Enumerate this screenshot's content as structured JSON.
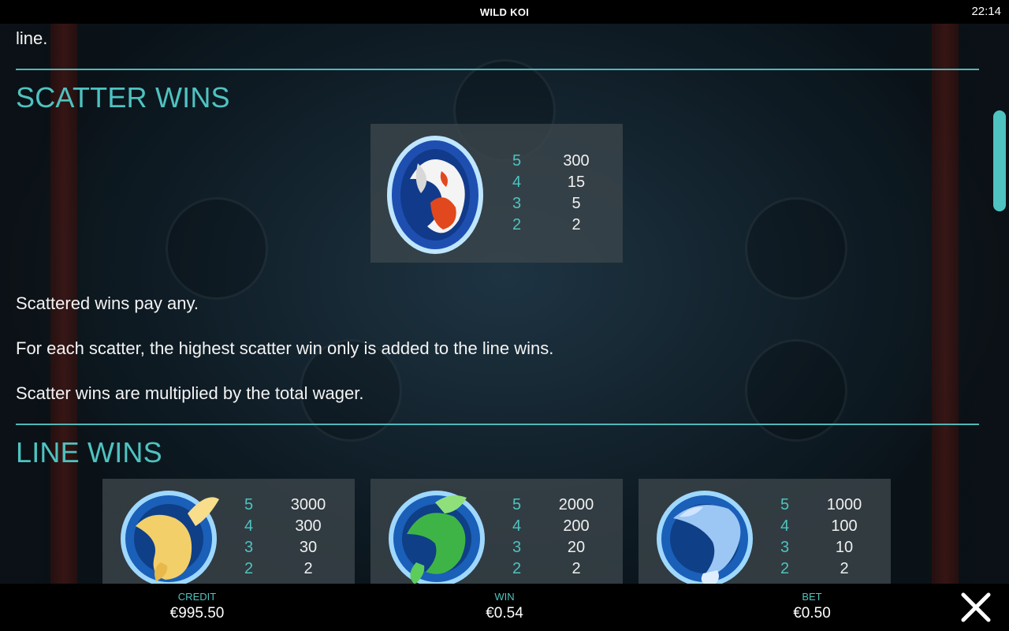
{
  "header": {
    "title": "WILD KOI",
    "clock": "22:14"
  },
  "intro_fragment": "line.",
  "scatter": {
    "heading": "SCATTER WINS",
    "symbol_icon": "scatter-koi-icon",
    "paytable": [
      {
        "count": "5",
        "value": "300"
      },
      {
        "count": "4",
        "value": "15"
      },
      {
        "count": "3",
        "value": "5"
      },
      {
        "count": "2",
        "value": "2"
      }
    ],
    "rules": [
      "Scattered wins pay any.",
      "For each scatter, the highest scatter win only is added to the line wins.",
      "Scatter wins are multiplied by the total wager."
    ]
  },
  "line_wins": {
    "heading": "LINE WINS",
    "symbols": [
      {
        "icon": "golden-koi-icon",
        "paytable": [
          {
            "count": "5",
            "value": "3000"
          },
          {
            "count": "4",
            "value": "300"
          },
          {
            "count": "3",
            "value": "30"
          },
          {
            "count": "2",
            "value": "2"
          }
        ]
      },
      {
        "icon": "green-koi-icon",
        "paytable": [
          {
            "count": "5",
            "value": "2000"
          },
          {
            "count": "4",
            "value": "200"
          },
          {
            "count": "3",
            "value": "20"
          },
          {
            "count": "2",
            "value": "2"
          }
        ]
      },
      {
        "icon": "blue-koi-icon",
        "paytable": [
          {
            "count": "5",
            "value": "1000"
          },
          {
            "count": "4",
            "value": "100"
          },
          {
            "count": "3",
            "value": "10"
          },
          {
            "count": "2",
            "value": "2"
          }
        ]
      }
    ]
  },
  "footer": {
    "credit_label": "CREDIT",
    "credit_value": "€995.50",
    "win_label": "WIN",
    "win_value": "€0.54",
    "bet_label": "BET",
    "bet_value": "€0.50",
    "close_icon": "close-icon"
  },
  "colors": {
    "accent": "#4ec3c0",
    "bar": "#000000",
    "card": "#3c464c"
  }
}
